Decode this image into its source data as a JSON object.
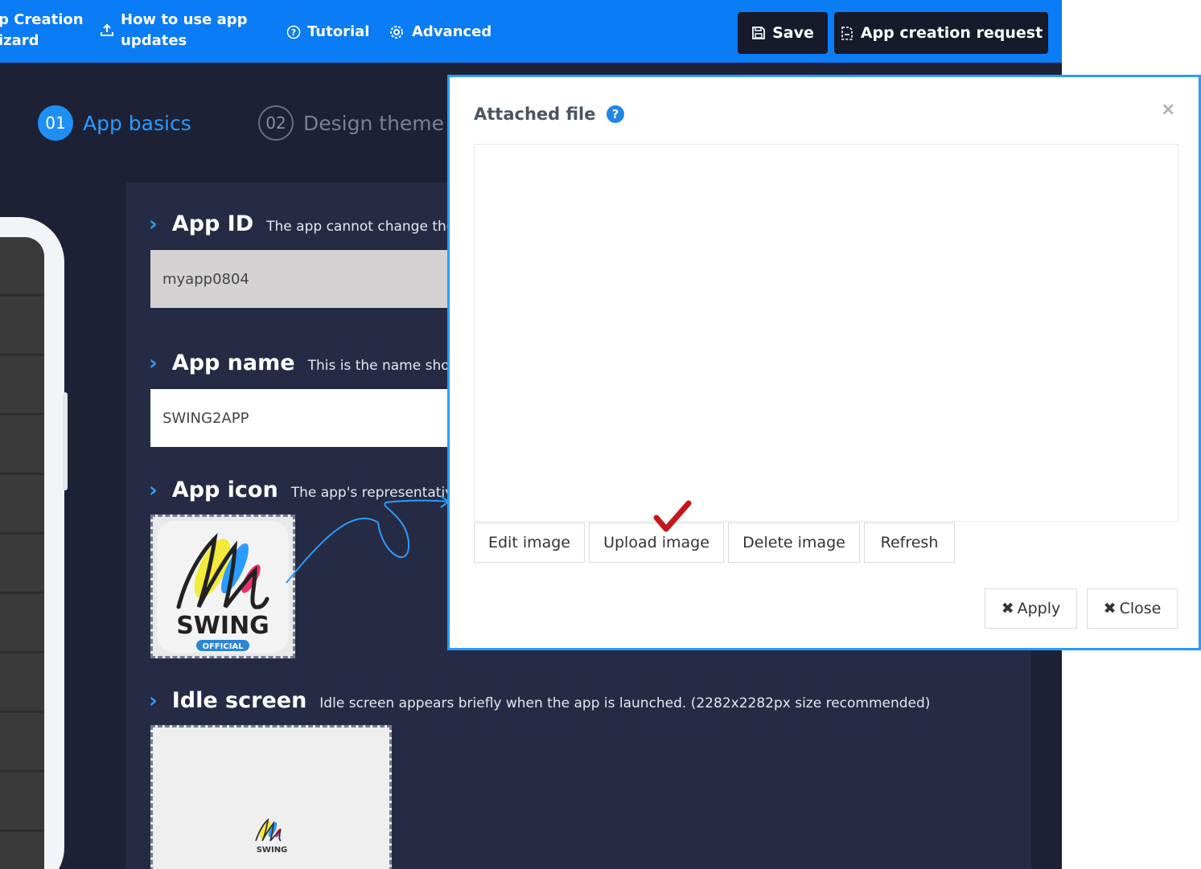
{
  "topbar": {
    "wizard_label": "p Creation\nizard",
    "updates_label": "How to use app\nupdates",
    "tutorial_label": "Tutorial",
    "advanced_label": "Advanced",
    "save_label": "Save",
    "request_label": "App creation request",
    "bg_color": "#0a7cf5"
  },
  "steps": [
    {
      "num": "01",
      "label": "App basics",
      "active": true
    },
    {
      "num": "02",
      "label": "Design theme",
      "active": false
    }
  ],
  "form": {
    "app_id": {
      "label": "App ID",
      "desc": "The app cannot change the u",
      "value": "myapp0804"
    },
    "app_name": {
      "label": "App name",
      "desc": "This is the name shown",
      "value": "SWING2APP"
    },
    "app_icon": {
      "label": "App icon",
      "desc": "The app's representative",
      "logo_text": "SWING",
      "logo_badge": "OFFICIAL"
    },
    "idle_screen": {
      "label": "Idle screen",
      "desc": "Idle screen appears briefly when the app is launched. (2282x2282px size recommended)",
      "logo_text": "SWING"
    }
  },
  "modal": {
    "title": "Attached file",
    "buttons": {
      "edit": "Edit image",
      "upload": "Upload image",
      "delete": "Delete image",
      "refresh": "Refresh",
      "apply": "Apply",
      "close": "Close"
    },
    "close_glyph": "×",
    "accent": "#2a9bff"
  }
}
